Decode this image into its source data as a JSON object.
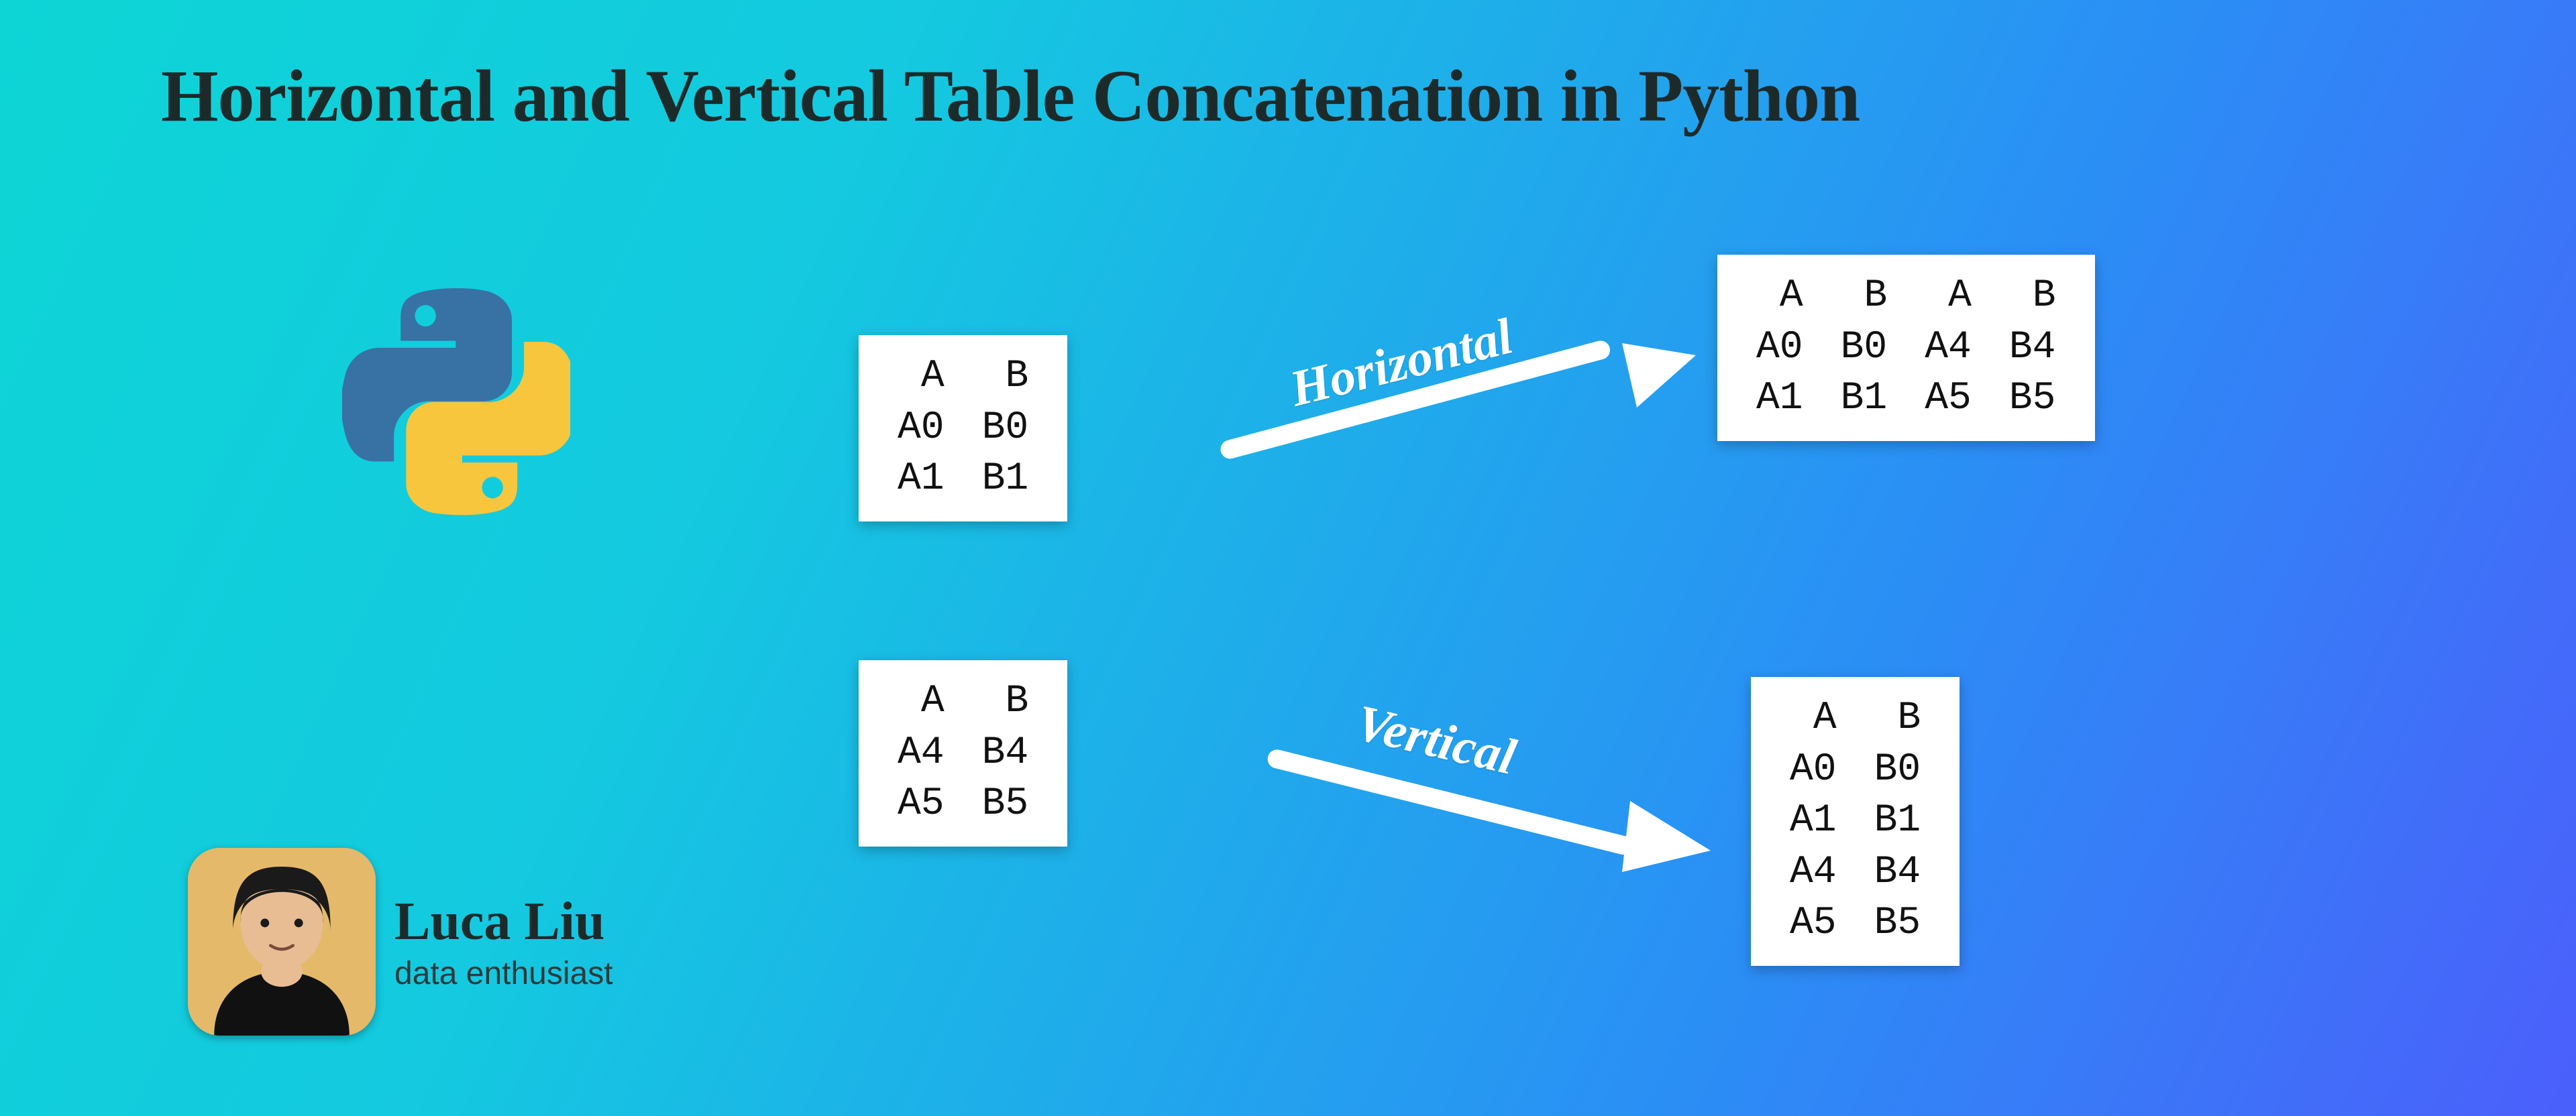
{
  "title": "Horizontal and Vertical Table Concatenation in Python",
  "author": {
    "name": "Luca Liu",
    "subtitle": "data enthusiast"
  },
  "icons": {
    "python": "python-logo-icon",
    "avatar": "avatar-photo"
  },
  "arrows": {
    "horizontal_label": "Horizontal",
    "vertical_label": "Vertical"
  },
  "tables": {
    "a": {
      "headers": [
        "A",
        "B"
      ],
      "rows": [
        [
          "A0",
          "B0"
        ],
        [
          "A1",
          "B1"
        ]
      ]
    },
    "b": {
      "headers": [
        "A",
        "B"
      ],
      "rows": [
        [
          "A4",
          "B4"
        ],
        [
          "A5",
          "B5"
        ]
      ]
    },
    "horizontal": {
      "headers": [
        "A",
        "B",
        "A",
        "B"
      ],
      "rows": [
        [
          "A0",
          "B0",
          "A4",
          "B4"
        ],
        [
          "A1",
          "B1",
          "A5",
          "B5"
        ]
      ]
    },
    "vertical": {
      "headers": [
        "A",
        "B"
      ],
      "rows": [
        [
          "A0",
          "B0"
        ],
        [
          "A1",
          "B1"
        ],
        [
          "A4",
          "B4"
        ],
        [
          "A5",
          "B5"
        ]
      ]
    }
  }
}
